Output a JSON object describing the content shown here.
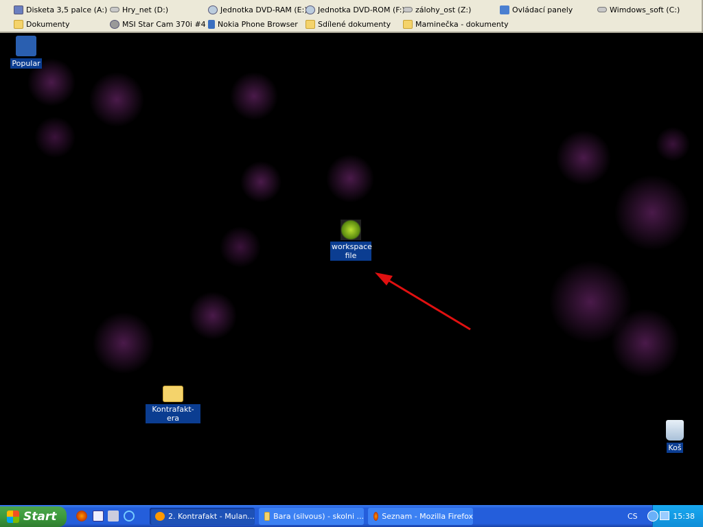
{
  "toolbar": {
    "row1": [
      {
        "label": "Disketa 3,5 palce (A:)",
        "icon": "floppy-icon"
      },
      {
        "label": "Hry_net (D:)",
        "icon": "network-drive-icon"
      },
      {
        "label": "Jednotka DVD-RAM (E:)",
        "icon": "dvd-drive-icon"
      },
      {
        "label": "Jednotka DVD-ROM (F:)",
        "icon": "dvd-drive-icon"
      },
      {
        "label": "zálohy_ost (Z:)",
        "icon": "network-drive-icon"
      },
      {
        "label": "Ovládací panely",
        "icon": "control-panel-icon"
      },
      {
        "label": "Wimdows_soft (C:)",
        "icon": "network-drive-icon"
      }
    ],
    "row2": [
      {
        "label": "Dokumenty",
        "icon": "folder-icon"
      },
      {
        "label": "MSI Star Cam 370i #4",
        "icon": "webcam-icon"
      },
      {
        "label": "Nokia Phone Browser",
        "icon": "phone-icon"
      },
      {
        "label": "Sdílené dokumenty",
        "icon": "folder-icon"
      },
      {
        "label": "Maminečka - dokumenty",
        "icon": "folder-icon"
      }
    ]
  },
  "desktop": {
    "icons": [
      {
        "label": "Popular"
      },
      {
        "label": "workspace file"
      },
      {
        "label": "Kontrafakt-era"
      },
      {
        "label": "Koš"
      }
    ]
  },
  "taskbar": {
    "start": "Start",
    "tasks": [
      {
        "label": "2. Kontrafakt - Mulan..."
      },
      {
        "label": "Bara (silvous) - skolni ..."
      },
      {
        "label": "Seznam - Mozilla Firefox"
      }
    ],
    "language": "CS",
    "clock": "15:38"
  },
  "colors": {
    "arrow": "#e01010",
    "taskbar": "#245edb",
    "selection": "#0b3d91"
  }
}
